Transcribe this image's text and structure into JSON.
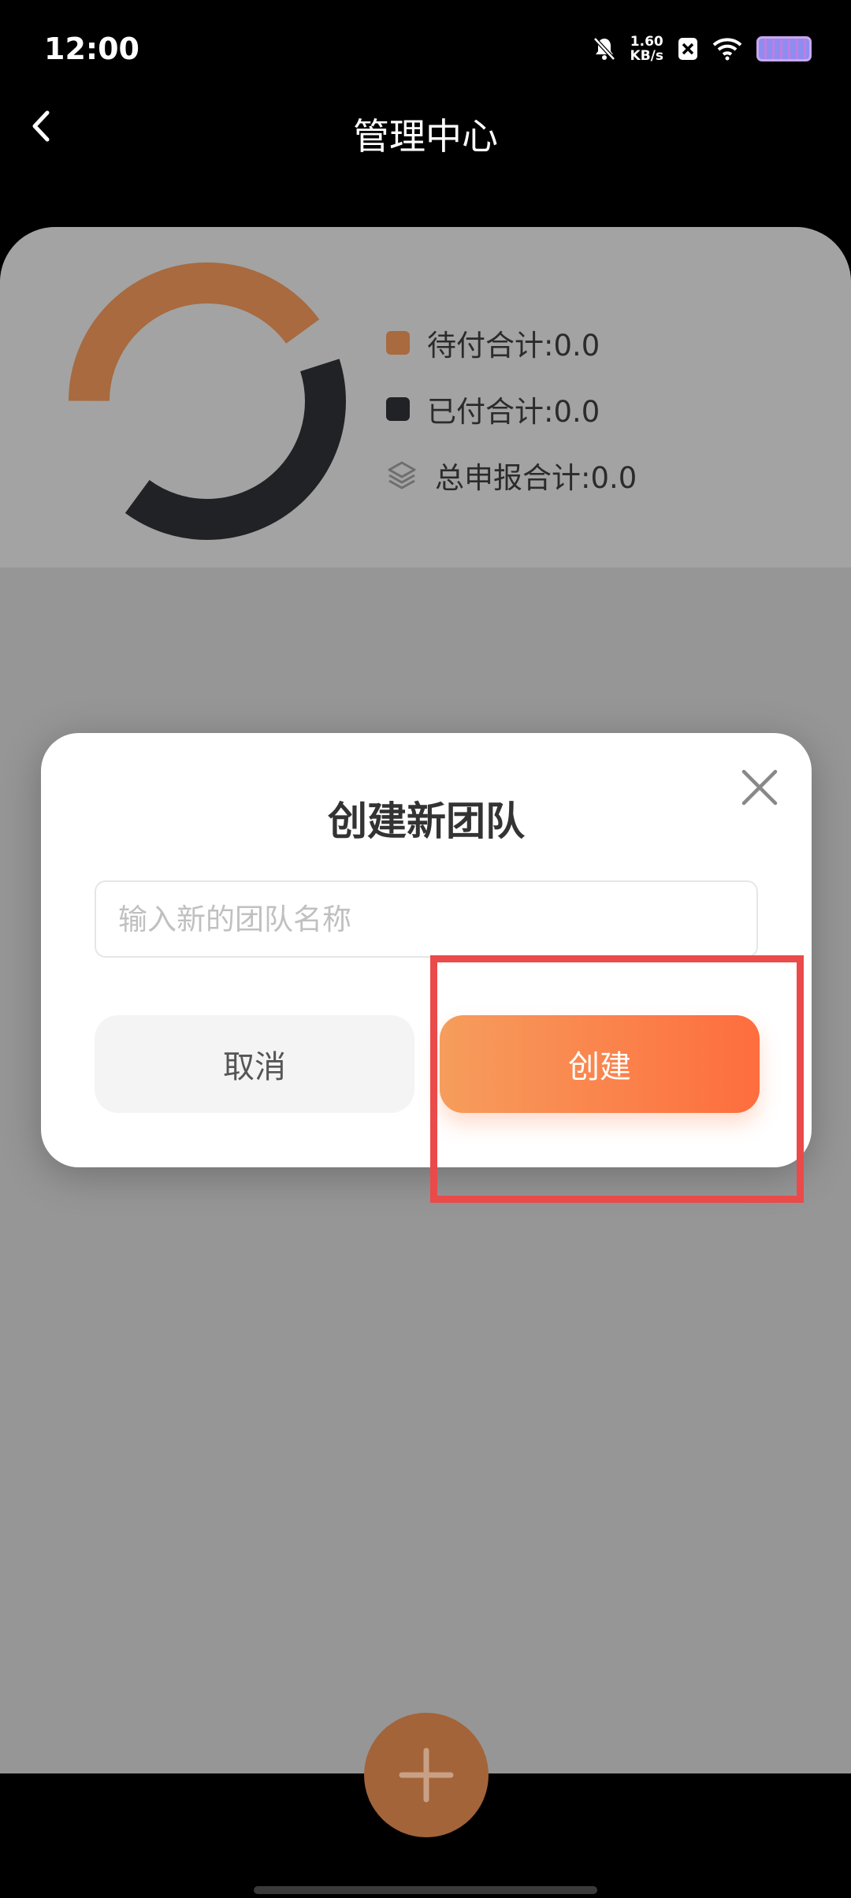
{
  "status_bar": {
    "time": "12:00",
    "net_speed_value": "1.60",
    "net_speed_unit": "KB/s"
  },
  "header": {
    "title": "管理中心"
  },
  "summary": {
    "legend": [
      {
        "label": "待付合计:0.0",
        "color": "#a86a3e"
      },
      {
        "label": "已付合计:0.0",
        "color": "#212225"
      },
      {
        "label": "总申报合计:0.0",
        "icon": "layers-icon"
      }
    ]
  },
  "dialog": {
    "title": "创建新团队",
    "input_placeholder": "输入新的团队名称",
    "input_value": "",
    "cancel_label": "取消",
    "create_label": "创建"
  },
  "colors": {
    "accent_start": "#f69d5c",
    "accent_end": "#fe6d3e",
    "highlight": "#ea4a4a",
    "fab": "#a3643a"
  }
}
